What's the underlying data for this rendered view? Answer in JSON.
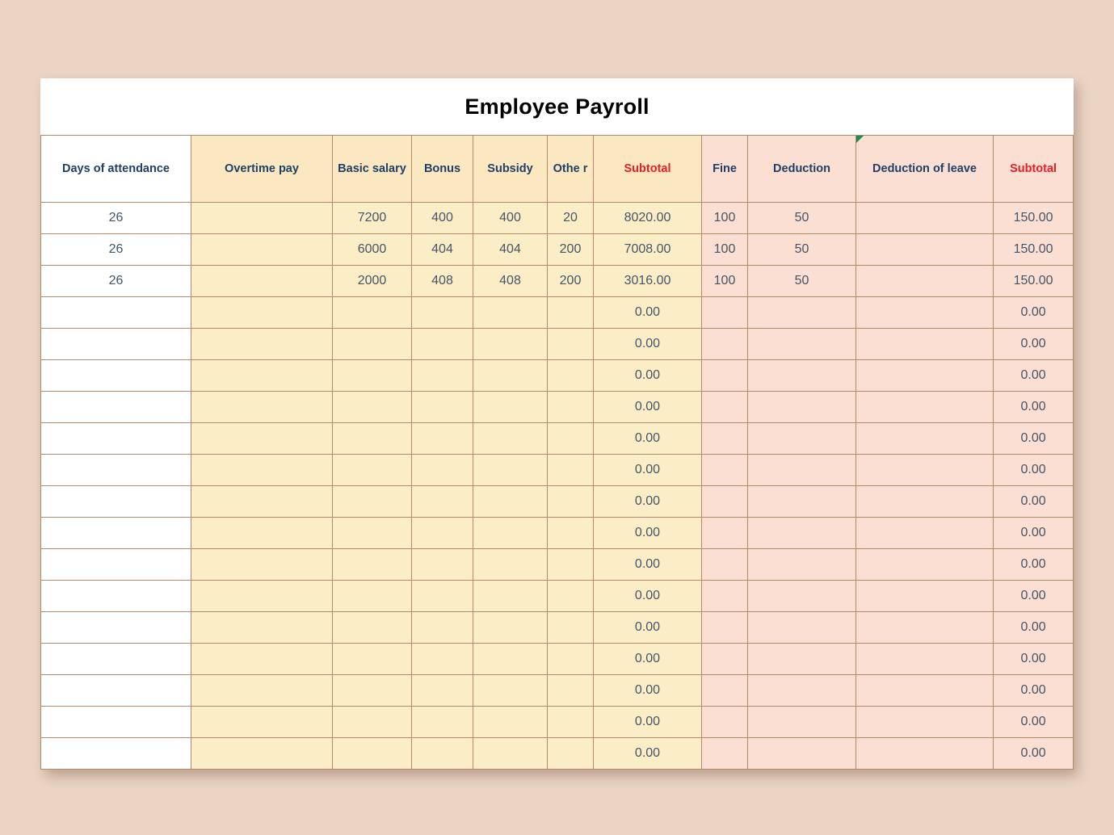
{
  "document": {
    "title": "Employee Payroll"
  },
  "colors": {
    "page_background": "#ead4c4",
    "header_yellow": "#fbe8c0",
    "header_pink": "#fbdfd2",
    "cell_yellow": "#fbeec6",
    "cell_pink": "#fbdfd2",
    "border": "#b08a6a",
    "header_text": "#1f3f66",
    "accent_red": "#ee1c25",
    "value_text": "#44546a",
    "comment_flag_green": "#1f8a46"
  },
  "table": {
    "columns": [
      {
        "key": "days_of_attendance",
        "label": "Days of attendance",
        "header_style": "white",
        "cell_style": "white",
        "label_color": "blue"
      },
      {
        "key": "overtime_pay",
        "label": "Overtime pay",
        "header_style": "yellow",
        "cell_style": "yellow",
        "label_color": "blue"
      },
      {
        "key": "basic_salary",
        "label": "Basic salary",
        "header_style": "yellow",
        "cell_style": "yellow",
        "label_color": "blue"
      },
      {
        "key": "bonus",
        "label": "Bonus",
        "header_style": "yellow",
        "cell_style": "yellow",
        "label_color": "blue"
      },
      {
        "key": "subsidy",
        "label": "Subsidy",
        "header_style": "yellow",
        "cell_style": "yellow",
        "label_color": "blue"
      },
      {
        "key": "other",
        "label": "Othe r",
        "header_style": "yellow",
        "cell_style": "yellow",
        "label_color": "blue"
      },
      {
        "key": "subtotal_earnings",
        "label": "Subtotal",
        "header_style": "yellow",
        "cell_style": "yellow",
        "label_color": "red"
      },
      {
        "key": "fine",
        "label": "Fine",
        "header_style": "pink",
        "cell_style": "pink",
        "label_color": "blue"
      },
      {
        "key": "deduction",
        "label": "Deduction",
        "header_style": "pink",
        "cell_style": "pink",
        "label_color": "blue"
      },
      {
        "key": "deduction_of_leave",
        "label": "Deduction of leave",
        "header_style": "pink",
        "cell_style": "pink",
        "label_color": "blue",
        "comment_flag": true
      },
      {
        "key": "subtotal_deductions",
        "label": "Subtotal",
        "header_style": "pink",
        "cell_style": "pink",
        "label_color": "red"
      }
    ],
    "rows": [
      {
        "days_of_attendance": "26",
        "overtime_pay": "",
        "basic_salary": "7200",
        "bonus": "400",
        "subsidy": "400",
        "other": "20",
        "subtotal_earnings": "8020.00",
        "fine": "100",
        "deduction": "50",
        "deduction_of_leave": "",
        "subtotal_deductions": "150.00"
      },
      {
        "days_of_attendance": "26",
        "overtime_pay": "",
        "basic_salary": "6000",
        "bonus": "404",
        "subsidy": "404",
        "other": "200",
        "subtotal_earnings": "7008.00",
        "fine": "100",
        "deduction": "50",
        "deduction_of_leave": "",
        "subtotal_deductions": "150.00"
      },
      {
        "days_of_attendance": "26",
        "overtime_pay": "",
        "basic_salary": "2000",
        "bonus": "408",
        "subsidy": "408",
        "other": "200",
        "subtotal_earnings": "3016.00",
        "fine": "100",
        "deduction": "50",
        "deduction_of_leave": "",
        "subtotal_deductions": "150.00"
      },
      {
        "days_of_attendance": "",
        "overtime_pay": "",
        "basic_salary": "",
        "bonus": "",
        "subsidy": "",
        "other": "",
        "subtotal_earnings": "0.00",
        "fine": "",
        "deduction": "",
        "deduction_of_leave": "",
        "subtotal_deductions": "0.00"
      },
      {
        "days_of_attendance": "",
        "overtime_pay": "",
        "basic_salary": "",
        "bonus": "",
        "subsidy": "",
        "other": "",
        "subtotal_earnings": "0.00",
        "fine": "",
        "deduction": "",
        "deduction_of_leave": "",
        "subtotal_deductions": "0.00"
      },
      {
        "days_of_attendance": "",
        "overtime_pay": "",
        "basic_salary": "",
        "bonus": "",
        "subsidy": "",
        "other": "",
        "subtotal_earnings": "0.00",
        "fine": "",
        "deduction": "",
        "deduction_of_leave": "",
        "subtotal_deductions": "0.00"
      },
      {
        "days_of_attendance": "",
        "overtime_pay": "",
        "basic_salary": "",
        "bonus": "",
        "subsidy": "",
        "other": "",
        "subtotal_earnings": "0.00",
        "fine": "",
        "deduction": "",
        "deduction_of_leave": "",
        "subtotal_deductions": "0.00"
      },
      {
        "days_of_attendance": "",
        "overtime_pay": "",
        "basic_salary": "",
        "bonus": "",
        "subsidy": "",
        "other": "",
        "subtotal_earnings": "0.00",
        "fine": "",
        "deduction": "",
        "deduction_of_leave": "",
        "subtotal_deductions": "0.00"
      },
      {
        "days_of_attendance": "",
        "overtime_pay": "",
        "basic_salary": "",
        "bonus": "",
        "subsidy": "",
        "other": "",
        "subtotal_earnings": "0.00",
        "fine": "",
        "deduction": "",
        "deduction_of_leave": "",
        "subtotal_deductions": "0.00"
      },
      {
        "days_of_attendance": "",
        "overtime_pay": "",
        "basic_salary": "",
        "bonus": "",
        "subsidy": "",
        "other": "",
        "subtotal_earnings": "0.00",
        "fine": "",
        "deduction": "",
        "deduction_of_leave": "",
        "subtotal_deductions": "0.00"
      },
      {
        "days_of_attendance": "",
        "overtime_pay": "",
        "basic_salary": "",
        "bonus": "",
        "subsidy": "",
        "other": "",
        "subtotal_earnings": "0.00",
        "fine": "",
        "deduction": "",
        "deduction_of_leave": "",
        "subtotal_deductions": "0.00"
      },
      {
        "days_of_attendance": "",
        "overtime_pay": "",
        "basic_salary": "",
        "bonus": "",
        "subsidy": "",
        "other": "",
        "subtotal_earnings": "0.00",
        "fine": "",
        "deduction": "",
        "deduction_of_leave": "",
        "subtotal_deductions": "0.00"
      },
      {
        "days_of_attendance": "",
        "overtime_pay": "",
        "basic_salary": "",
        "bonus": "",
        "subsidy": "",
        "other": "",
        "subtotal_earnings": "0.00",
        "fine": "",
        "deduction": "",
        "deduction_of_leave": "",
        "subtotal_deductions": "0.00"
      },
      {
        "days_of_attendance": "",
        "overtime_pay": "",
        "basic_salary": "",
        "bonus": "",
        "subsidy": "",
        "other": "",
        "subtotal_earnings": "0.00",
        "fine": "",
        "deduction": "",
        "deduction_of_leave": "",
        "subtotal_deductions": "0.00"
      },
      {
        "days_of_attendance": "",
        "overtime_pay": "",
        "basic_salary": "",
        "bonus": "",
        "subsidy": "",
        "other": "",
        "subtotal_earnings": "0.00",
        "fine": "",
        "deduction": "",
        "deduction_of_leave": "",
        "subtotal_deductions": "0.00"
      },
      {
        "days_of_attendance": "",
        "overtime_pay": "",
        "basic_salary": "",
        "bonus": "",
        "subsidy": "",
        "other": "",
        "subtotal_earnings": "0.00",
        "fine": "",
        "deduction": "",
        "deduction_of_leave": "",
        "subtotal_deductions": "0.00"
      },
      {
        "days_of_attendance": "",
        "overtime_pay": "",
        "basic_salary": "",
        "bonus": "",
        "subsidy": "",
        "other": "",
        "subtotal_earnings": "0.00",
        "fine": "",
        "deduction": "",
        "deduction_of_leave": "",
        "subtotal_deductions": "0.00"
      },
      {
        "days_of_attendance": "",
        "overtime_pay": "",
        "basic_salary": "",
        "bonus": "",
        "subsidy": "",
        "other": "",
        "subtotal_earnings": "0.00",
        "fine": "",
        "deduction": "",
        "deduction_of_leave": "",
        "subtotal_deductions": "0.00"
      }
    ]
  }
}
